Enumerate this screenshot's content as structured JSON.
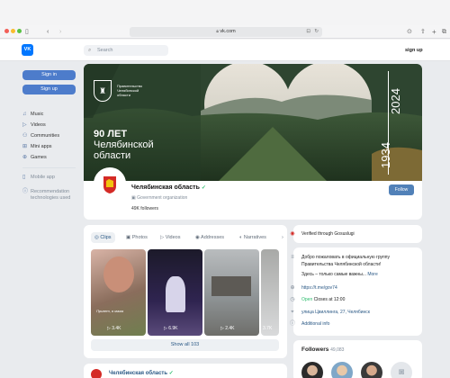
{
  "browser": {
    "url": "vk.com"
  },
  "header": {
    "search_placeholder": "Search",
    "signup_label": "sign up",
    "logo_text": "VK"
  },
  "sidebar": {
    "signin_label": "Sign in",
    "signup_label": "Sign up",
    "items": [
      {
        "label": "Music",
        "icon": "music-icon"
      },
      {
        "label": "Videos",
        "icon": "video-icon"
      },
      {
        "label": "Communities",
        "icon": "communities-icon"
      },
      {
        "label": "Mini apps",
        "icon": "mini-apps-icon"
      },
      {
        "label": "Games",
        "icon": "games-icon"
      }
    ],
    "mobile_app": "Mobile app",
    "recommendation": [
      "Recommendation",
      "technologies used"
    ]
  },
  "cover": {
    "emblem_text": [
      "Правительство",
      "Челябинской",
      "области"
    ],
    "anniversary": [
      "90 ЛЕТ",
      "Челябинской",
      "области"
    ],
    "year_end": "2024",
    "year_start": "1934"
  },
  "group": {
    "name": "Челябинская область",
    "type": "Government organization",
    "followers": "49K followers",
    "follow_label": "Follow"
  },
  "tabs": [
    {
      "label": "Clips",
      "active": true
    },
    {
      "label": "Photos",
      "active": false
    },
    {
      "label": "Videos",
      "active": false
    },
    {
      "label": "Addresses",
      "active": false
    },
    {
      "label": "Narratives",
      "active": false
    }
  ],
  "clips": [
    {
      "views": "3.4K",
      "caption": "Привет, я мама"
    },
    {
      "views": "6.9K"
    },
    {
      "views": "2.4K"
    },
    {
      "views": "3.7K"
    }
  ],
  "show_all": "Show all 103",
  "info": {
    "verified": "Verified through Gosuslugi",
    "welcome": [
      "Добро пожаловать в официальную группу",
      "Правительства Челябинской области!"
    ],
    "welcome_more": "Здесь – только самые важны...",
    "more_label": "More",
    "link": "https://t.me/gov74",
    "open_label": "Open",
    "closes": "Closes at 12:00",
    "address": "улица Цвиллинга, 27, Челябинск",
    "additional": "Additional info"
  },
  "followers": {
    "label": "Followers",
    "count": "49,083"
  },
  "post": {
    "name": "Челябинская область"
  }
}
